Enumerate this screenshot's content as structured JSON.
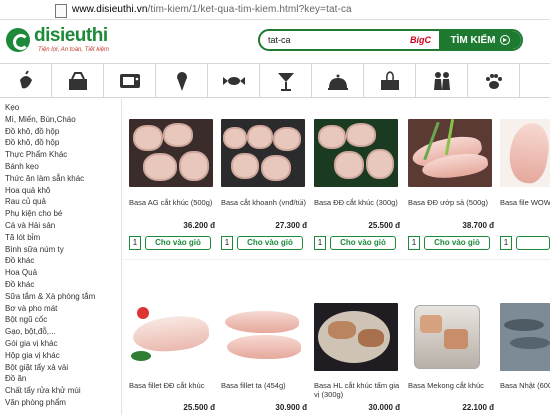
{
  "browser": {
    "url_domain": "www.disieuthi.vn",
    "url_rest": "/tim-kiem/1/ket-qua-tim-kiem.html?key=tat-ca"
  },
  "header": {
    "logo_name": "disieuthi",
    "logo_tagline": "Tiện lợi, An toàn, Tiết kiệm",
    "search_value": "tat-ca",
    "search_partner": "BigC",
    "search_button": "TÌM KIẾM"
  },
  "category_icons": [
    "fruit-icon",
    "groceries-icon",
    "appliance-icon",
    "ice-cream-icon",
    "candy-icon",
    "cocktail-icon",
    "cooking-icon",
    "tissue-icon",
    "family-icon",
    "pet-paw-icon"
  ],
  "sidebar": {
    "items": [
      "Kẹo",
      "Mì, Miến, Bún,Cháo",
      "Đồ khô, đồ hộp",
      "Đồ khô, đồ hộp",
      "Thực Phẩm Khác",
      "Bánh kẹo",
      "Thức ăn làm sẵn khác",
      "Hoa quả khô",
      "Rau củ quả",
      "Phụ kiện cho bé",
      "Cá và Hải sản",
      "Tã lót bỉm",
      "Bình sữa núm ty",
      "Đồ khác",
      "Hoa Quả",
      "Đồ khác",
      "Sữa tắm & Xà phòng tắm",
      "Bơ và pho mát",
      "Bột ngũ cốc",
      "Gạo, bột,đỗ,...",
      "Gói gia vị khác",
      "Hộp gia vị khác",
      "Bột giặt tẩy xả vải",
      "Đồ ăn",
      "Chất tẩy rửa khử mùi",
      "Văn phòng phẩm"
    ]
  },
  "products": [
    {
      "name": "Basa AG cắt khúc (500g)",
      "price": "36.200 đ",
      "qty": "1",
      "cart": "Cho vào giỏ"
    },
    {
      "name": "Basa cắt khoanh (vnđ/túi)",
      "price": "27.300 đ",
      "qty": "1",
      "cart": "Cho vào giỏ"
    },
    {
      "name": "Basa ĐĐ cắt khúc (300g)",
      "price": "25.500 đ",
      "qty": "1",
      "cart": "Cho vào giỏ"
    },
    {
      "name": "Basa ĐĐ ướp sả (500g)",
      "price": "38.700 đ",
      "qty": "1",
      "cart": "Cho vào giỏ"
    },
    {
      "name": "Basa file WOW",
      "price": "",
      "qty": "1",
      "cart": ""
    },
    {
      "name": "Basa fillet ĐĐ cắt khúc",
      "price": "25.500 đ"
    },
    {
      "name": "Basa fillet ta (454g)",
      "price": "30.900 đ"
    },
    {
      "name": "Basa HL cắt khúc tẩm gia vị (300g)",
      "price": "30.000 đ"
    },
    {
      "name": "Basa Mekong cắt khúc",
      "price": "22.100 đ"
    },
    {
      "name": "Basa Nhật (600 HSSG",
      "price": ""
    }
  ]
}
